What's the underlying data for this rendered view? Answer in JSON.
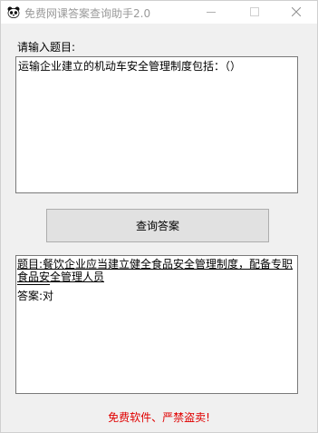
{
  "window": {
    "title": "免费网课答案查询助手2.0",
    "app_icon": "panda-icon",
    "controls": [
      "minimize-icon",
      "maximize-icon",
      "close-icon"
    ]
  },
  "prompt_label": "请输入题目:",
  "question_input": {
    "value": "运输企业建立的机动车安全管理制度包括：（）"
  },
  "query_button": {
    "label": "查询答案"
  },
  "result": {
    "question": "题目:餐饮企业应当建立健全食品安全管理制度，配备专职食品安全管理人员",
    "answer": "答案:对"
  },
  "footer_note": "免费软件、严禁盗卖!",
  "colors": {
    "footer": "#e00000",
    "button_bg": "#e1e1e1",
    "title_text": "#9a9a9a"
  }
}
